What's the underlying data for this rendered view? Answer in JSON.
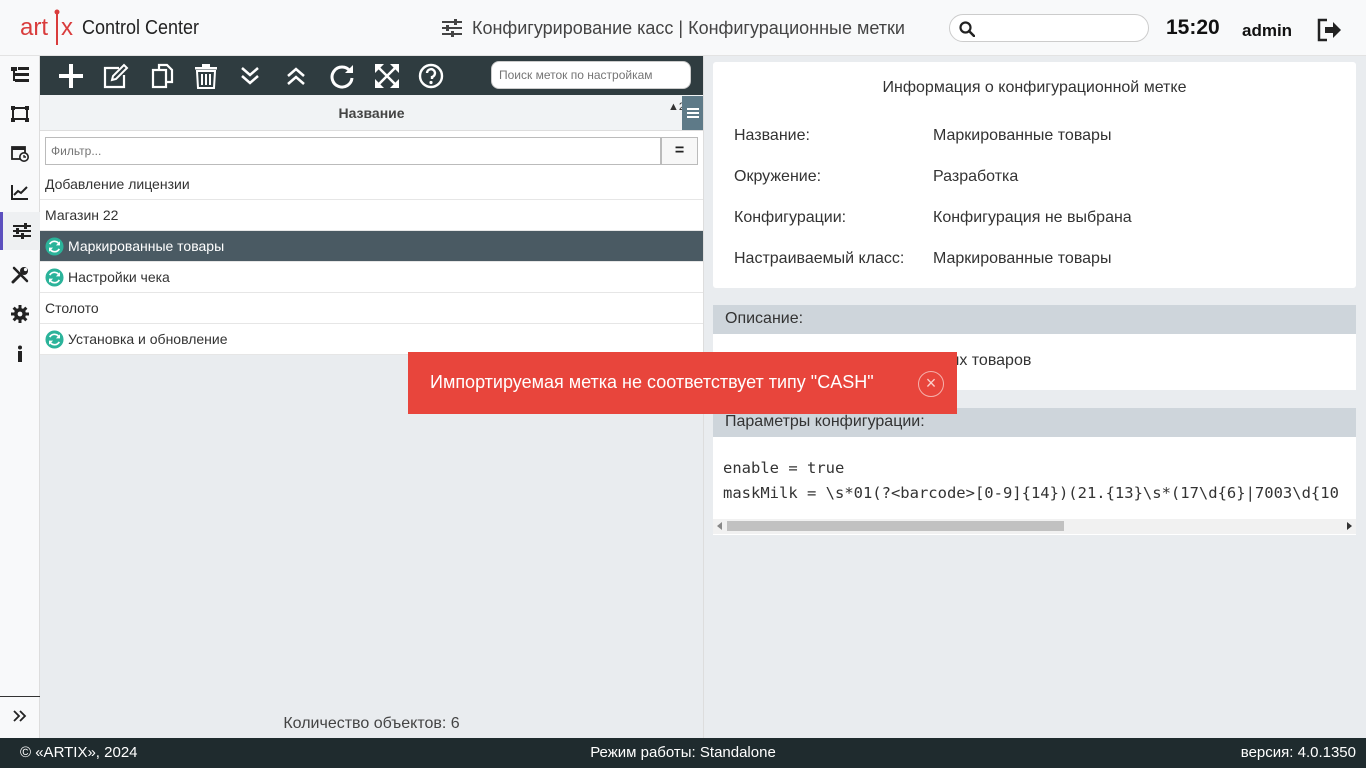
{
  "header": {
    "logo_text": "artix",
    "app_name": "Control Center",
    "page_title": "Конфигурирование касс | Конфигурационные метки",
    "search_placeholder": "",
    "time": "15:20",
    "user": "admin"
  },
  "nav": {
    "items": [
      "tree-icon",
      "terminal-icon",
      "calendar-clock-icon",
      "chart-icon",
      "sliders-icon",
      "tools-icon",
      "gear-icon",
      "info-icon"
    ],
    "active": "sliders-icon"
  },
  "toolbar": {
    "buttons": [
      "add",
      "edit",
      "copy",
      "delete",
      "expand-all",
      "collapse-all",
      "refresh",
      "fullscreen",
      "help"
    ],
    "search_placeholder": "Поиск меток по настройкам"
  },
  "list": {
    "column_title": "Название",
    "sort_indicator": "▲2",
    "filter_placeholder": "Фильтр...",
    "filter_mode": "=",
    "rows": [
      {
        "label": "Добавление лицензии",
        "synced": false,
        "selected": false
      },
      {
        "label": "Магазин 22",
        "synced": false,
        "selected": false
      },
      {
        "label": "Маркированные товары",
        "synced": true,
        "selected": true
      },
      {
        "label": "Настройки чека",
        "synced": true,
        "selected": false
      },
      {
        "label": "Столото",
        "synced": false,
        "selected": false
      },
      {
        "label": "Установка и обновление",
        "synced": true,
        "selected": false
      }
    ],
    "count_text": "Количество объектов: 6"
  },
  "info": {
    "title": "Информация о конфигурационной метке",
    "fields": [
      {
        "label": "Название:",
        "value": "Маркированные товары"
      },
      {
        "label": "Окружение:",
        "value": "Разработка"
      },
      {
        "label": "Конфигурации:",
        "value": "Конфигурация не выбрана"
      },
      {
        "label": "Настраиваемый класс:",
        "value": "Маркированные товары"
      }
    ]
  },
  "description": {
    "header": "Описание:",
    "text_visible": "ных товаров"
  },
  "params": {
    "header": "Параметры конфигурации:",
    "text": "enable = true\nmaskMilk = \\s*01(?<barcode>[0-9]{14})(21.{13}\\s*(17\\d{6}|7003\\d{10"
  },
  "toast": {
    "message": "Импортируемая метка не соответствует типу \"CASH\"",
    "close": "×"
  },
  "footer": {
    "copyright": "© «ARTIX», 2024",
    "mode": "Режим работы: Standalone",
    "version": "версия: 4.0.1350"
  },
  "colors": {
    "toolbar_bg": "#2f3c40",
    "selected_row": "#4a5a63",
    "toast_bg": "#e8453c",
    "footer_bg": "#1f2b2e",
    "accent_nav": "#5b4fbe",
    "sync_icon": "#2bb39a"
  }
}
